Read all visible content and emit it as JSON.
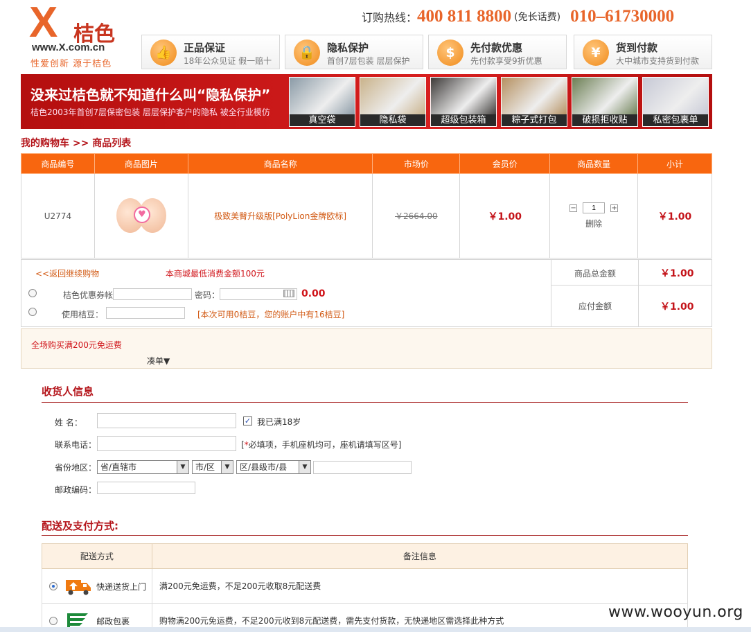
{
  "logo": {
    "mark": "X",
    "cn_name": "桔色",
    "url": "www.X.com.cn",
    "slogan": "性爱创新  源于桔色"
  },
  "hotline": {
    "label": "订购热线：",
    "number1": "400 811 8800",
    "free": "(免长话费)",
    "number2": "010–61730000"
  },
  "promises": [
    {
      "title": "正品保证",
      "sub": "18年公众见证  假一赔十",
      "icon": "thumbs-up-icon",
      "glyph": "👍"
    },
    {
      "title": "隐私保护",
      "sub": "首创7层包装  层层保护",
      "icon": "lock-icon",
      "glyph": "🔒"
    },
    {
      "title": "先付款优惠",
      "sub": "先付款享受9折优惠",
      "icon": "dollar-icon",
      "glyph": "$"
    },
    {
      "title": "货到付款",
      "sub": "大中城市支持货到付款",
      "icon": "house-icon",
      "glyph": "¥"
    }
  ],
  "banner": {
    "title": "没来过桔色就不知道什么叫“隐私保护”",
    "sub": "桔色2003年首创7层保密包装 层层保护客户的隐私 被全行业模仿",
    "thumbs": [
      {
        "caption": "真空袋",
        "color": "#8a9aa6"
      },
      {
        "caption": "隐私袋",
        "color": "#c9b28a"
      },
      {
        "caption": "超级包装箱",
        "color": "#3d3a38"
      },
      {
        "caption": "粽子式打包",
        "color": "#b59060"
      },
      {
        "caption": "破损拒收贴",
        "color": "#6c7f54"
      },
      {
        "caption": "私密包裹单",
        "color": "#c7c9d6"
      }
    ]
  },
  "breadcrumb": "我的购物车  >>  商品列表",
  "cart": {
    "headers": [
      "商品编号",
      "商品图片",
      "商品名称",
      "市场价",
      "会员价",
      "商品数量",
      "小计"
    ],
    "item": {
      "code": "U2774",
      "name": "极致美臀升级版[PolyLion金牌欧标]",
      "market_price": "￥2664.00",
      "member_price": "￥1.00",
      "qty": "1",
      "minus": "−",
      "plus": "+",
      "delete": "删除",
      "subtotal": "￥1.00"
    }
  },
  "summary": {
    "back": "<<返回继续购物",
    "min_note": "本商城最低消费金额100元",
    "total_label": "商品总金额",
    "total": "￥1.00",
    "coupon_label": "桔色优惠券帐号：",
    "password_label": "密码：",
    "coupon_amount": "0.00",
    "beans_label": "使用桔豆：",
    "beans_note": "[本次可用0桔豆，您的账户中有16桔豆]",
    "pay_label": "应付金额",
    "pay": "￥1.00"
  },
  "promo": {
    "text": "全场购买满200元免运费",
    "combo": "凑单▼"
  },
  "receiver": {
    "title": "收货人信息",
    "name_label": "姓     名：",
    "adult_label": "我已满18岁",
    "phone_label": "联系电话：",
    "phone_note_pre": "[",
    "phone_note_req": "*",
    "phone_note": "必填项，手机座机均可，座机请填写区号]",
    "region_label": "省份地区：",
    "province": "省/直辖市",
    "city": "市/区",
    "county": "区/县级市/县",
    "zip_label": "邮政编码："
  },
  "delivery": {
    "title": "配送及支付方式:",
    "headers": [
      "配送方式",
      "备注信息"
    ],
    "options": [
      {
        "name": "快递送货上门",
        "note": "满200元免运费，不足200元收取8元配送费",
        "selected": true
      },
      {
        "name": "邮政包裹",
        "note": "购物满200元免运费，不足200元收到8元配送费，需先支付货款，无快递地区需选择此种方式",
        "selected": false
      }
    ]
  },
  "watermark": "www.wooyun.org"
}
